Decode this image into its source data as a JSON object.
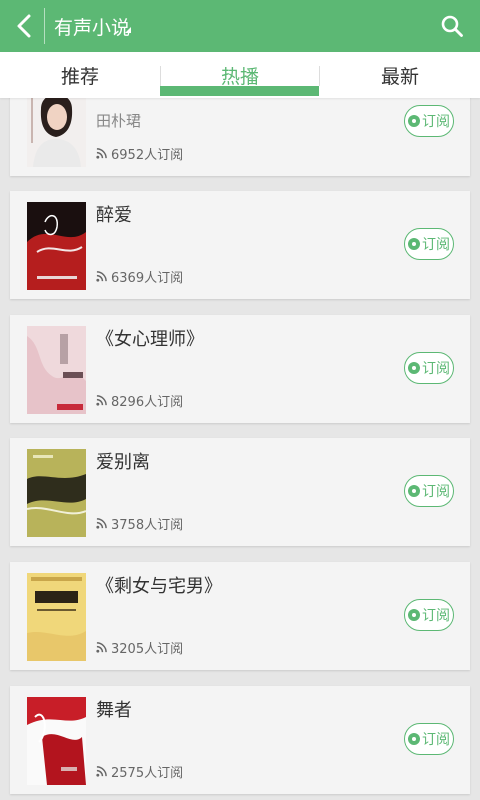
{
  "header": {
    "title": "有声小说",
    "back_icon": "back-arrow-icon",
    "search_icon": "search-icon",
    "color": "#5cb874"
  },
  "tabs": [
    {
      "label": "推荐",
      "active": false
    },
    {
      "label": "热播",
      "active": true
    },
    {
      "label": "最新",
      "active": false
    }
  ],
  "subscribe_label": "订阅",
  "books": [
    {
      "title": "",
      "author": "田朴珺",
      "subscribers": "6952人订阅"
    },
    {
      "title": "醉爱",
      "author": "",
      "subscribers": "6369人订阅"
    },
    {
      "title": "《女心理师》",
      "author": "",
      "subscribers": "8296人订阅"
    },
    {
      "title": "爱别离",
      "author": "",
      "subscribers": "3758人订阅"
    },
    {
      "title": "《剩女与宅男》",
      "author": "",
      "subscribers": "3205人订阅"
    },
    {
      "title": "舞者",
      "author": "",
      "subscribers": "2575人订阅"
    }
  ]
}
